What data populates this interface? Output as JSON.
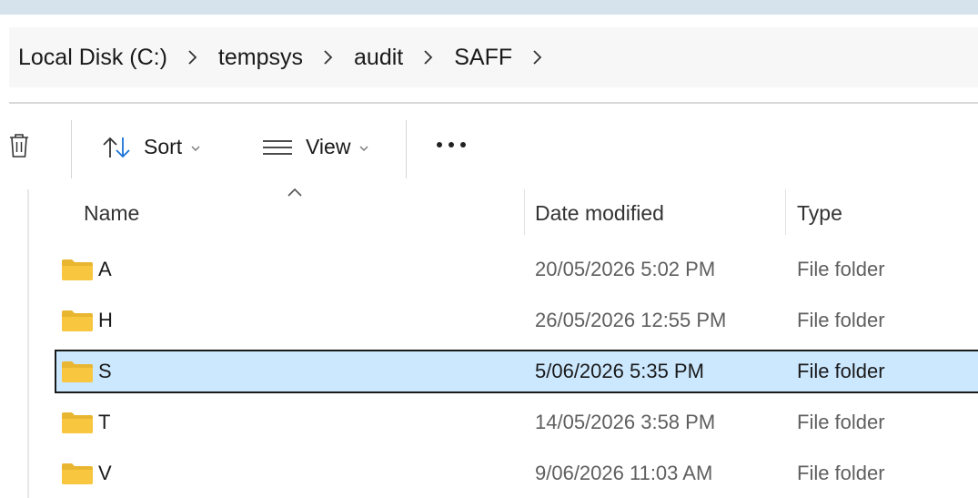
{
  "breadcrumb": {
    "items": [
      {
        "label": "Local Disk (C:)"
      },
      {
        "label": "tempsys"
      },
      {
        "label": "audit"
      },
      {
        "label": "SAFF"
      }
    ]
  },
  "toolbar": {
    "delete_icon": "trash-icon",
    "sort_label": "Sort",
    "view_label": "View",
    "more_icon": "more-horizontal-icon"
  },
  "columns": {
    "name": "Name",
    "date_modified": "Date modified",
    "type": "Type"
  },
  "files": [
    {
      "name": "A",
      "date_modified": "20/05/2026 5:02 PM",
      "type": "File folder",
      "selected": false
    },
    {
      "name": "H",
      "date_modified": "26/05/2026 12:55 PM",
      "type": "File folder",
      "selected": false
    },
    {
      "name": "S",
      "date_modified": "5/06/2026 5:35 PM",
      "type": "File folder",
      "selected": true
    },
    {
      "name": "T",
      "date_modified": "14/05/2026 3:58 PM",
      "type": "File folder",
      "selected": false
    },
    {
      "name": "V",
      "date_modified": "9/06/2026 11:03 AM",
      "type": "File folder",
      "selected": false
    }
  ],
  "colors": {
    "selection_background": "#cce8ff",
    "folder_yellow": "#f8c73f",
    "accent_blue": "#1a73d9"
  }
}
